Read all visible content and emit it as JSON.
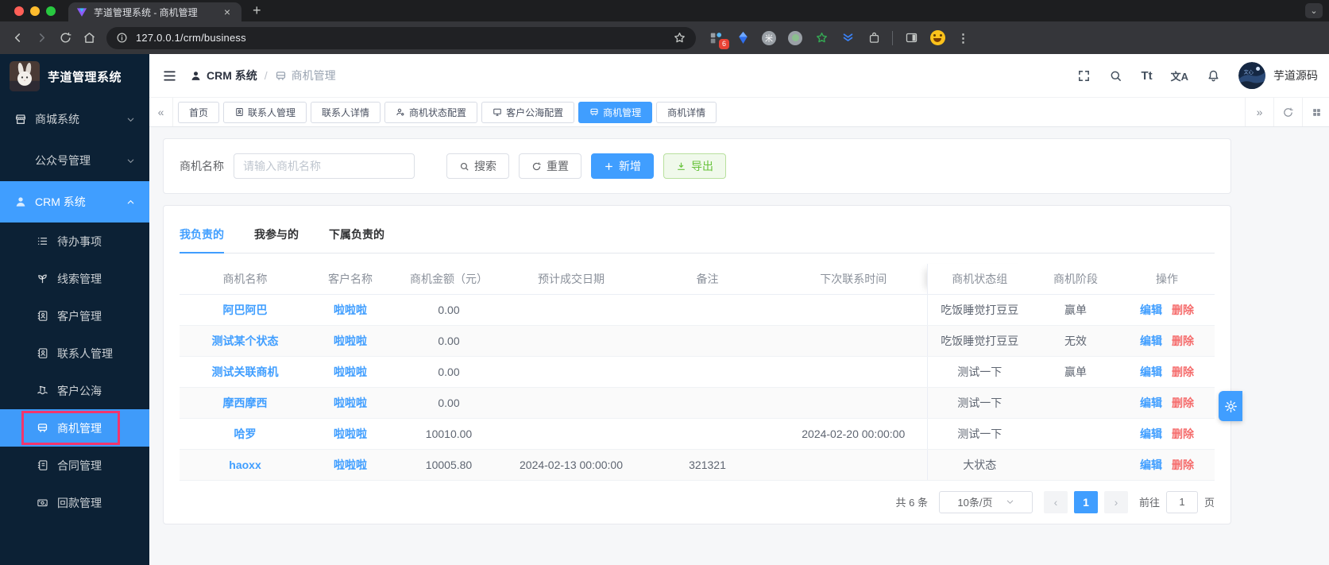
{
  "browser": {
    "tab_title": "芋道管理系统 - 商机管理",
    "url": "127.0.0.1/crm/business",
    "extensions_badge": "6"
  },
  "icons": {
    "close": "×",
    "plus": "+",
    "more": "⋮",
    "collapse_left": "«",
    "collapse_right": "»",
    "prev": "‹",
    "next": "›",
    "chevron_down": "⌄",
    "font_size": "Tt",
    "language": "文A",
    "rice": "米"
  },
  "sidebar": {
    "app_title": "芋道管理系统",
    "menu": [
      {
        "label": "商城系统",
        "icon": "shop-icon",
        "expanded": false
      },
      {
        "label": "公众号管理",
        "icon": "",
        "expanded": false
      },
      {
        "label": "CRM 系统",
        "icon": "user-icon",
        "expanded": true,
        "active": true
      },
      {
        "label": "待办事项",
        "icon": "todo-list-icon"
      },
      {
        "label": "线索管理",
        "icon": "clue-icon"
      },
      {
        "label": "客户管理",
        "icon": "customer-book-icon"
      },
      {
        "label": "联系人管理",
        "icon": "contact-book-icon"
      },
      {
        "label": "客户公海",
        "icon": "sea-icon"
      },
      {
        "label": "商机管理",
        "icon": "bus-icon",
        "active": true,
        "annotated": true
      },
      {
        "label": "合同管理",
        "icon": "contract-icon"
      },
      {
        "label": "回款管理",
        "icon": "payment-icon"
      }
    ]
  },
  "header": {
    "breadcrumb": {
      "root": "CRM 系统",
      "separator": "/",
      "current": "商机管理"
    },
    "username": "芋道源码"
  },
  "tags": {
    "tabs": [
      {
        "label": "首页"
      },
      {
        "label": "联系人管理",
        "icon": "contact-book-icon"
      },
      {
        "label": "联系人详情"
      },
      {
        "label": "商机状态配置",
        "icon": "user-gear-icon"
      },
      {
        "label": "客户公海配置",
        "icon": "monitor-icon"
      },
      {
        "label": "商机管理",
        "icon": "bus-icon",
        "active": true
      },
      {
        "label": "商机详情"
      }
    ]
  },
  "filter": {
    "label": "商机名称",
    "placeholder": "请输入商机名称",
    "search": "搜索",
    "reset": "重置",
    "add": "新增",
    "export": "导出"
  },
  "panel": {
    "tabs": [
      {
        "label": "我负责的",
        "active": true
      },
      {
        "label": "我参与的"
      },
      {
        "label": "下属负责的"
      }
    ]
  },
  "table": {
    "columns": [
      "商机名称",
      "客户名称",
      "商机金额（元）",
      "预计成交日期",
      "备注",
      "下次联系时间",
      "商机状态组",
      "商机阶段",
      "操作"
    ],
    "actions": {
      "edit": "编辑",
      "delete": "删除"
    },
    "rows": [
      {
        "name": "阿巴阿巴",
        "customer": "啦啦啦",
        "amount": "0.00",
        "expected_date": "",
        "remark": "",
        "next_contact": "",
        "status_group": "吃饭睡觉打豆豆",
        "stage": "赢单"
      },
      {
        "name": "测试某个状态",
        "customer": "啦啦啦",
        "amount": "0.00",
        "expected_date": "",
        "remark": "",
        "next_contact": "",
        "status_group": "吃饭睡觉打豆豆",
        "stage": "无效"
      },
      {
        "name": "测试关联商机",
        "customer": "啦啦啦",
        "amount": "0.00",
        "expected_date": "",
        "remark": "",
        "next_contact": "",
        "status_group": "测试一下",
        "stage": "赢单"
      },
      {
        "name": "摩西摩西",
        "customer": "啦啦啦",
        "amount": "0.00",
        "expected_date": "",
        "remark": "",
        "next_contact": "",
        "status_group": "测试一下",
        "stage": ""
      },
      {
        "name": "哈罗",
        "customer": "啦啦啦",
        "amount": "10010.00",
        "expected_date": "",
        "remark": "",
        "next_contact": "2024-02-20 00:00:00",
        "status_group": "测试一下",
        "stage": ""
      },
      {
        "name": "haoxx",
        "customer": "啦啦啦",
        "amount": "10005.80",
        "expected_date": "2024-02-13 00:00:00",
        "remark": "321321",
        "next_contact": "",
        "status_group": "大状态",
        "stage": ""
      }
    ],
    "pagination": {
      "total": "共 6 条",
      "page_size": "10条/页",
      "current_page": "1",
      "goto_label": "前往",
      "goto_value": "1",
      "unit": "页"
    }
  },
  "colors": {
    "primary": "#409eff",
    "danger": "#f56c6c",
    "success": "#67c23a",
    "sidebar_bg": "#0c2135",
    "annotation": "#f2356d",
    "chrome_bg": "#35363a"
  }
}
